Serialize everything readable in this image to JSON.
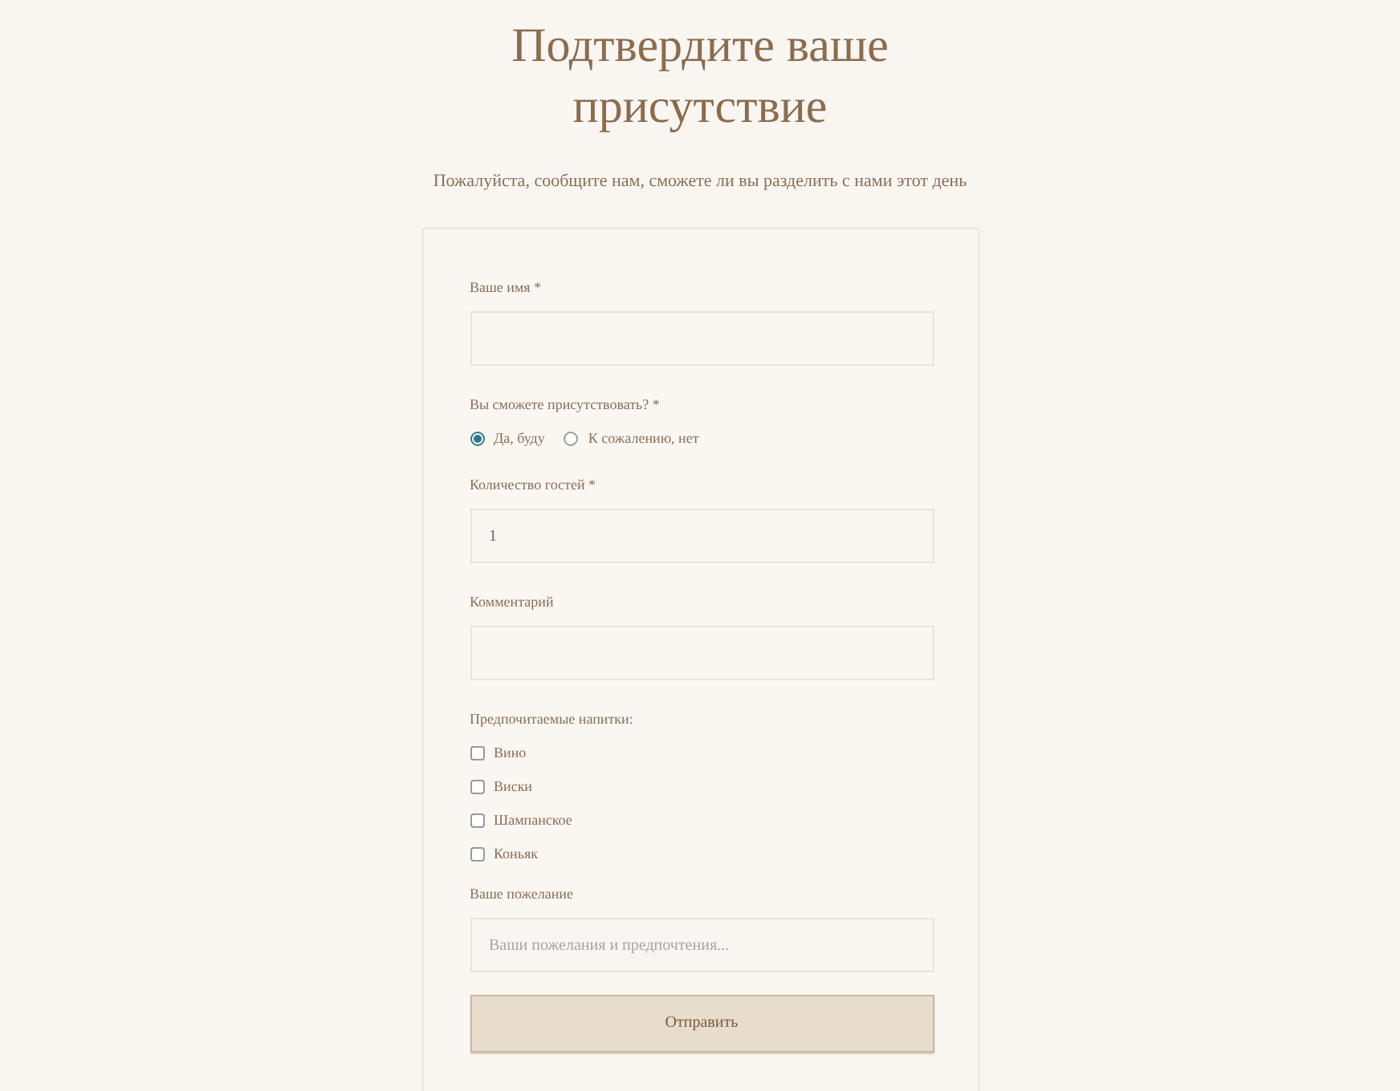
{
  "title": "Подтвердите ваше присутствие",
  "subtitle": "Пожалуйста, сообщите нам, сможете ли вы разделить с нами этот день",
  "fields": [
    {
      "kind": "input",
      "label": "Ваше имя *"
    },
    {
      "kind": "radio",
      "label": "Вы сможете присутствовать? *",
      "options": [
        {
          "label": "Да, буду",
          "selected": true
        },
        {
          "label": "К сожалению, нет",
          "selected": false
        }
      ]
    },
    {
      "kind": "input",
      "label": "Количество гостей *",
      "value": "1"
    },
    {
      "kind": "input",
      "label": "Комментарий"
    },
    {
      "kind": "checkboxes",
      "label": "Предпочитаемые напитки:",
      "options": [
        {
          "label": "Вино",
          "checked": false
        },
        {
          "label": "Виски",
          "checked": false
        },
        {
          "label": "Шампанское",
          "checked": false
        },
        {
          "label": "Коньяк",
          "checked": false
        }
      ]
    },
    {
      "kind": "input",
      "label": "Ваше пожелание",
      "placeholder": "Ваши пожелания и предпочтения..."
    }
  ],
  "submit": "Отправить"
}
